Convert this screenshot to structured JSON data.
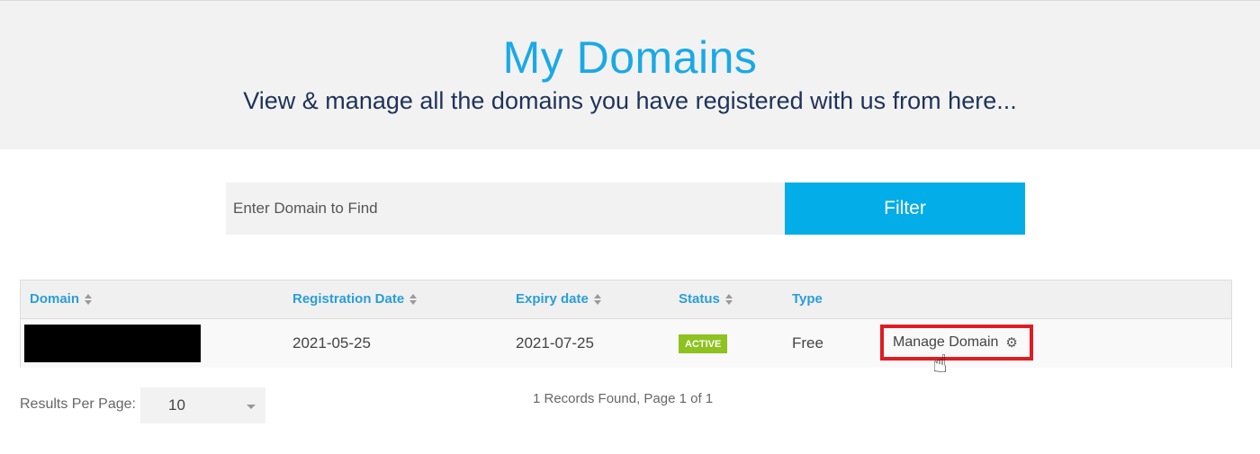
{
  "header": {
    "title": "My Domains",
    "subtitle": "View & manage all the domains you have registered with us from here..."
  },
  "search": {
    "placeholder": "Enter Domain to Find",
    "button_label": "Filter"
  },
  "table": {
    "columns": [
      "Domain",
      "Registration Date",
      "Expiry date",
      "Status",
      "Type"
    ],
    "rows": [
      {
        "domain": "",
        "registration_date": "2021-05-25",
        "expiry_date": "2021-07-25",
        "status": "ACTIVE",
        "type": "Free",
        "action_label": "Manage Domain"
      }
    ]
  },
  "pagination": {
    "results_per_page_label": "Results Per Page:",
    "results_per_page_value": "10",
    "records_text": "1 Records Found, Page 1 of 1"
  },
  "colors": {
    "accent": "#02ade8",
    "status_active": "#8dc21f",
    "highlight_box": "#e11b22"
  },
  "icons": {
    "sort": "sort-icon",
    "settings": "gear-icon",
    "cursor": "hand-cursor-icon",
    "dropdown": "caret-down-icon"
  }
}
